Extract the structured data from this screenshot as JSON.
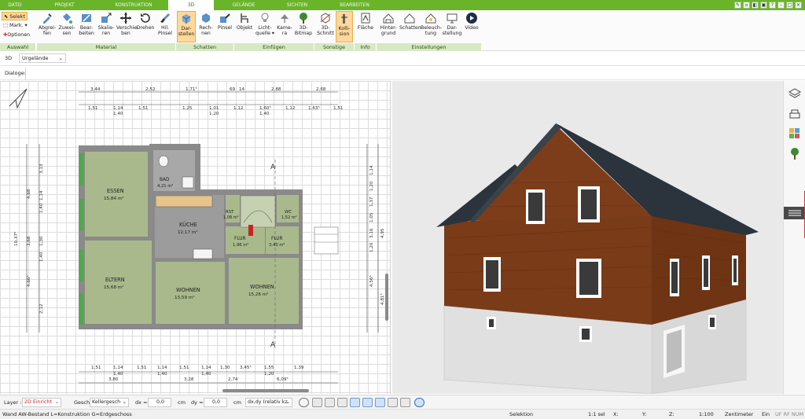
{
  "tabs": [
    {
      "label": "DATEI"
    },
    {
      "label": "PROJEKT"
    },
    {
      "label": "KONSTRUKTION"
    },
    {
      "label": "3D"
    },
    {
      "label": "GELÄNDE"
    },
    {
      "label": "SICHTEN"
    },
    {
      "label": "BEARBEITEN"
    }
  ],
  "ribbon": {
    "auswahl": {
      "select": "Selekt",
      "mark": "Mark.",
      "options": "Optionen",
      "group": "Auswahl"
    },
    "material": {
      "buttons": [
        {
          "l1": "Abgrei-",
          "l2": "fen"
        },
        {
          "l1": "Zuwei-",
          "l2": "sen"
        },
        {
          "l1": "Bear-",
          "l2": "beiten"
        },
        {
          "l1": "Skalie-",
          "l2": "ren"
        },
        {
          "l1": "Verschie-",
          "l2": "ben"
        },
        {
          "l1": "Drehen",
          "l2": ""
        },
        {
          "l1": "Hil.",
          "l2": "Pinsel"
        }
      ],
      "group": "Material"
    },
    "schatten": {
      "buttons": [
        {
          "l1": "Dar-",
          "l2": "stellen"
        },
        {
          "l1": "Rech-",
          "l2": "nen"
        },
        {
          "l1": "Pinsel",
          "l2": ""
        }
      ],
      "group": "Schatten"
    },
    "einfuegen": {
      "buttons": [
        {
          "l1": "Objekt",
          "l2": ""
        },
        {
          "l1": "Licht-",
          "l2": "quelle ▾"
        },
        {
          "l1": "Kame-",
          "l2": "ra"
        },
        {
          "l1": "3D-",
          "l2": "Bitmap"
        }
      ],
      "group": "Einfügen"
    },
    "sonstige": {
      "buttons": [
        {
          "l1": "3D-",
          "l2": "Schnitt"
        },
        {
          "l1": "Kolli-",
          "l2": "sion"
        }
      ],
      "group": "Sonstige"
    },
    "info": {
      "buttons": [
        {
          "l1": "Fläche",
          "l2": ""
        }
      ],
      "group": "Info"
    },
    "einstellungen": {
      "buttons": [
        {
          "l1": "Hinter-",
          "l2": "grund"
        },
        {
          "l1": "Schatten",
          "l2": ""
        },
        {
          "l1": "Beleuch-",
          "l2": "tung"
        },
        {
          "l1": "Dar-",
          "l2": "stellung"
        },
        {
          "l1": "Video",
          "l2": ""
        }
      ],
      "group": "Einstellungen"
    }
  },
  "viewbar": {
    "mode": "3D",
    "terrain": "Urgelände"
  },
  "dialog_label": "Dialoge:",
  "plan": {
    "rooms": [
      {
        "name": "ESSEN",
        "area": "15,84 m²"
      },
      {
        "name": "BAD",
        "area": "4,21 m²"
      },
      {
        "name": "KÜCHE",
        "area": "12,17 m²"
      },
      {
        "name": "RST",
        "area": "1,08 m²"
      },
      {
        "name": "WC",
        "area": "1,52 m²"
      },
      {
        "name": "FLUR",
        "area": "1,96 m²"
      },
      {
        "name": "FLUR",
        "area": "3,43 m²"
      },
      {
        "name": "ELTERN",
        "area": "15,68 m²"
      },
      {
        "name": "WOHNEN",
        "area": "13,59 m²"
      },
      {
        "name": "WOHNEN",
        "area": "15,26 m²"
      }
    ],
    "dims_top1": [
      "3,44",
      "2,52",
      "1,71⁵",
      "69",
      "14",
      "2,88",
      "2,68"
    ],
    "dims_top2": [
      "1,51",
      "1,14",
      "1,51",
      "1,25",
      "1,01",
      "1,12",
      "1,60⁵",
      "1,12",
      "1,63⁵",
      "1,51"
    ],
    "dims_top2_sub": [
      "1,40",
      "1,20",
      "1,40"
    ],
    "dims_bottom1": [
      "1,51",
      "1,14",
      "1,51",
      "1,14",
      "1,51",
      "1,14",
      "1,30",
      "3,45⁵",
      "1,55",
      "1,39"
    ],
    "dims_bottom1_sub": [
      "1,40",
      "1,40",
      "1,40",
      "1,20"
    ],
    "dims_bottom2": [
      "3,80",
      "3,28",
      "2,74",
      "6,09⁵"
    ],
    "dims_left": [
      "3,13",
      "4,68",
      "1,14",
      "1,40",
      "3,68",
      "1,30",
      "1,40",
      "4,66⁵",
      "2,12",
      "10,37⁵"
    ],
    "dims_right": [
      "1,14",
      "1,20",
      "1,37",
      "1,05",
      "3,16",
      "1,20",
      "4,56⁵",
      "4,95",
      "4,81⁵"
    ],
    "section_label": "A"
  },
  "toolbar": {
    "layer_label": "Layer :",
    "layer_value": "2D Einricht",
    "geschoss_label": "Geschoss :",
    "geschoss_value": "Kellergesch",
    "dx_label": "dx =",
    "dx_value": "0,0",
    "dy_label": "dy =",
    "dy_value": "0,0",
    "unit": "cm",
    "mode_value": "dx,dy (relativ kz"
  },
  "status": {
    "left": "Wand AW-Bestand L=Konstruktion G=Erdgeschoss",
    "mode": "Selektion",
    "sel": "1:1 sel",
    "x": "X:",
    "y": "Y:",
    "z": "Z:",
    "scale": "1:100",
    "unit": "Zentimeter",
    "ein": "Ein",
    "flags": "UF RF NUM"
  },
  "colors": {
    "accent": "#6ab42a",
    "wood": "#7a3b18",
    "roof": "#2b333c"
  }
}
